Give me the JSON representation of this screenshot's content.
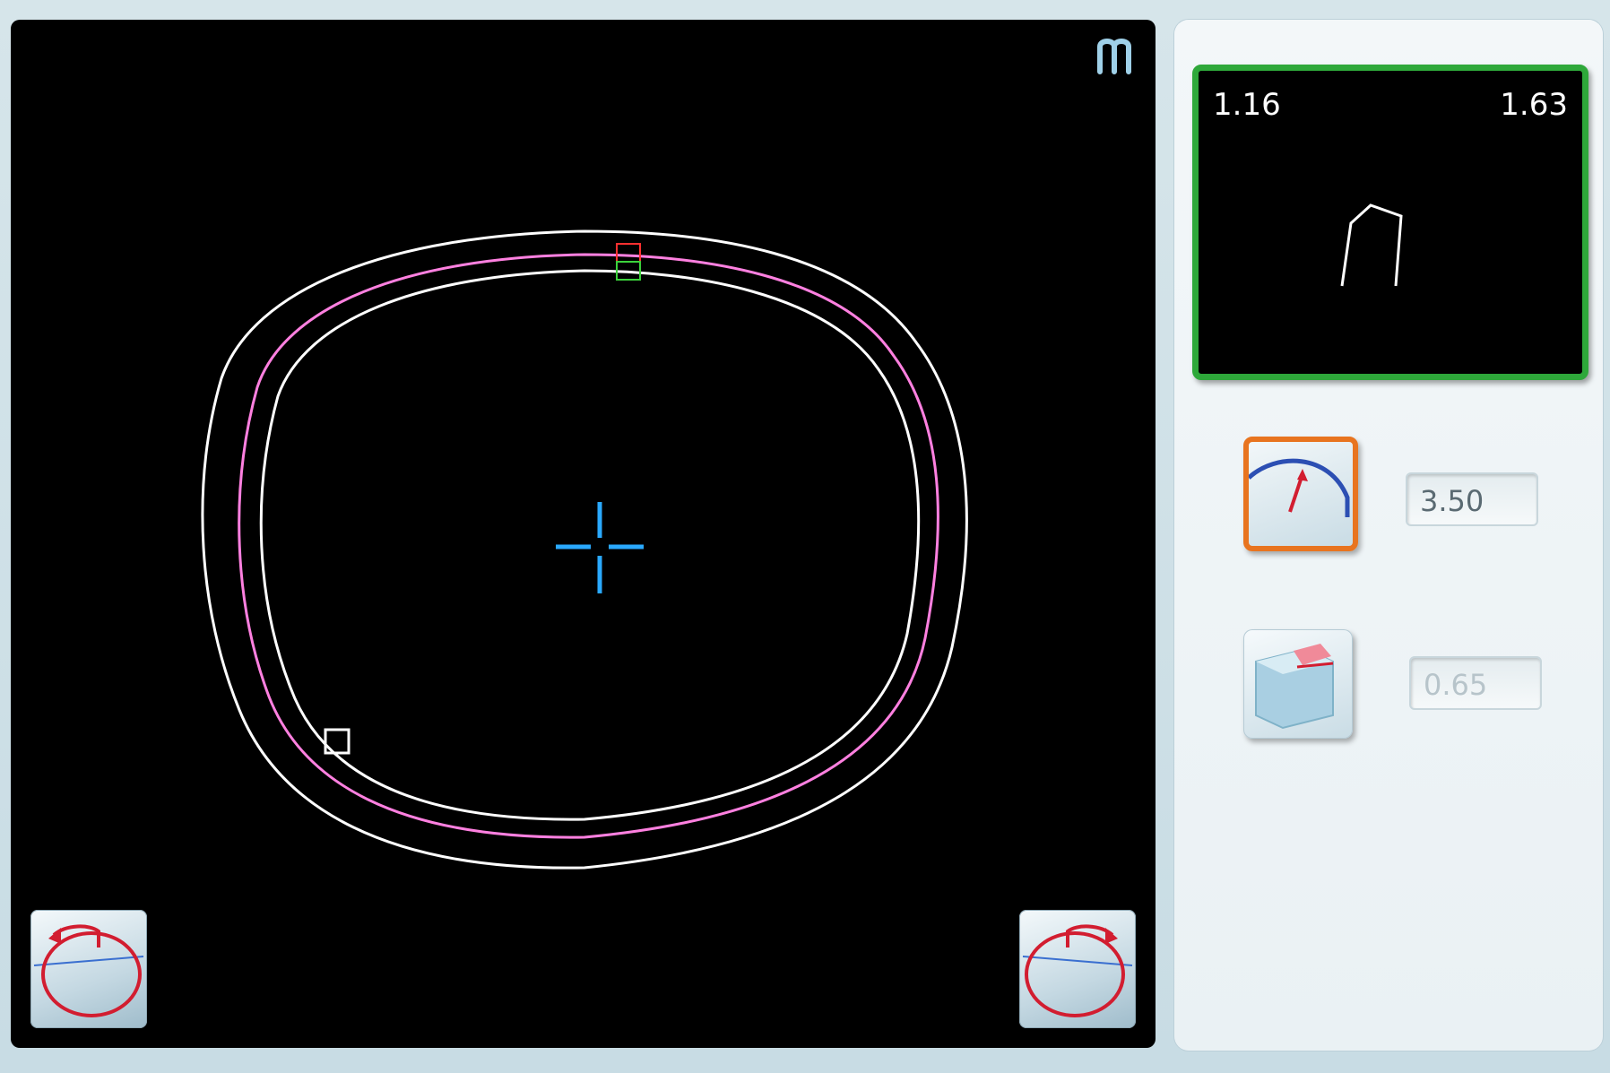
{
  "lens_view": {
    "brand_icon": "brand-logo-icon",
    "rotate_left_icon": "rotate-left-icon",
    "rotate_right_icon": "rotate-right-icon",
    "colors": {
      "outline": "#ffffff",
      "bevel_line": "#ff80e0",
      "center_cross": "#2aa9ff",
      "marker_red": "#ff3030",
      "marker_green": "#3cd23c"
    }
  },
  "profile": {
    "left_value": "1.16",
    "right_value": "1.63",
    "border_color": "#2ea83a"
  },
  "bevel": {
    "icon": "bevel-gauge-icon",
    "value": "3.50",
    "highlight_color": "#e8741f"
  },
  "polish": {
    "icon": "edge-polish-icon",
    "value": "0.65"
  }
}
